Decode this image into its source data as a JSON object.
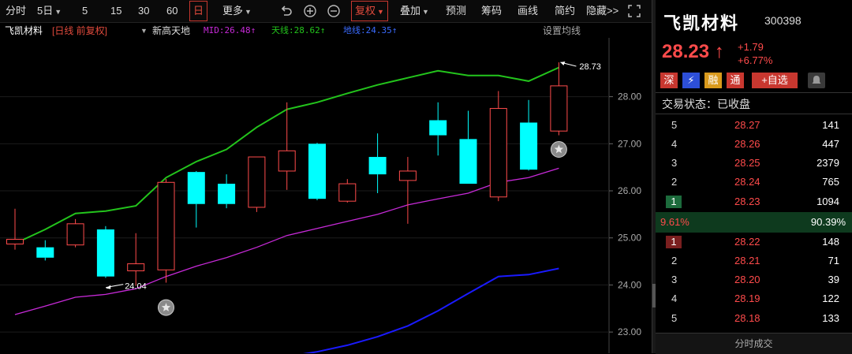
{
  "toolbar": {
    "items": [
      "分时",
      "5日",
      "5",
      "15",
      "30",
      "60",
      "日",
      "更多",
      "复权",
      "叠加",
      "预测",
      "筹码",
      "画线",
      "简约",
      "隐藏>>"
    ]
  },
  "infobar": {
    "name": "飞凯材料",
    "mode": "[日线 前复权]",
    "indicator": "新高天地",
    "mid": "MID:26.48↑",
    "tianxian": "天线:28.62↑",
    "dixian": "地线:24.35↑",
    "settings": "设置均线"
  },
  "colors": {
    "up": "#ff4b4b",
    "down": "#00ffff",
    "green": "#23c41c",
    "mid": "#c72ad8",
    "low": "#1a1aff",
    "accent": "#c8372f"
  },
  "chart_data": {
    "type": "candlestick",
    "y_ticks": [
      "28.00",
      "27.00",
      "26.00",
      "25.00",
      "24.00",
      "23.00"
    ],
    "ylim": [
      22.55,
      29.25
    ],
    "candles": [
      {
        "o": 24.87,
        "h": 25.62,
        "l": 24.75,
        "c": 24.97
      },
      {
        "o": 24.8,
        "h": 24.95,
        "l": 24.52,
        "c": 24.58
      },
      {
        "o": 24.85,
        "h": 25.4,
        "l": 24.8,
        "c": 25.3
      },
      {
        "o": 25.18,
        "h": 25.25,
        "l": 24.15,
        "c": 24.18
      },
      {
        "o": 24.3,
        "h": 25.1,
        "l": 23.98,
        "c": 24.45
      },
      {
        "o": 24.32,
        "h": 26.25,
        "l": 24.05,
        "c": 26.18
      },
      {
        "o": 26.4,
        "h": 26.42,
        "l": 25.22,
        "c": 25.72
      },
      {
        "o": 26.15,
        "h": 26.35,
        "l": 25.63,
        "c": 25.72
      },
      {
        "o": 25.65,
        "h": 26.72,
        "l": 25.55,
        "c": 26.72
      },
      {
        "o": 26.42,
        "h": 27.88,
        "l": 26.02,
        "c": 26.85
      },
      {
        "o": 27.0,
        "h": 27.02,
        "l": 25.8,
        "c": 25.83
      },
      {
        "o": 25.78,
        "h": 26.25,
        "l": 25.75,
        "c": 26.15
      },
      {
        "o": 26.72,
        "h": 27.22,
        "l": 25.95,
        "c": 26.35
      },
      {
        "o": 26.22,
        "h": 26.72,
        "l": 25.3,
        "c": 26.42
      },
      {
        "o": 27.5,
        "h": 27.88,
        "l": 26.75,
        "c": 27.18
      },
      {
        "o": 27.1,
        "h": 27.7,
        "l": 26.15,
        "c": 26.15
      },
      {
        "o": 25.87,
        "h": 28.12,
        "l": 25.78,
        "c": 27.75
      },
      {
        "o": 27.45,
        "h": 27.93,
        "l": 26.43,
        "c": 26.45
      },
      {
        "o": 27.27,
        "h": 28.73,
        "l": 27.18,
        "c": 28.23
      }
    ],
    "series": [
      {
        "name": "天线",
        "color": "#23c41c",
        "values": [
          24.88,
          25.18,
          25.52,
          25.57,
          25.68,
          26.28,
          26.62,
          26.88,
          27.35,
          27.73,
          27.88,
          28.07,
          28.25,
          28.4,
          28.55,
          28.45,
          28.45,
          28.33,
          28.62
        ]
      },
      {
        "name": "MID",
        "color": "#c72ad8",
        "values": [
          23.37,
          23.55,
          23.74,
          23.8,
          23.92,
          24.18,
          24.4,
          24.58,
          24.8,
          25.05,
          25.2,
          25.35,
          25.5,
          25.7,
          25.83,
          25.95,
          26.18,
          26.28,
          26.48
        ]
      },
      {
        "name": "地线",
        "color": "#1a1aff",
        "values": [
          null,
          null,
          null,
          null,
          null,
          null,
          null,
          null,
          null,
          22.48,
          22.58,
          22.72,
          22.9,
          23.13,
          23.45,
          23.82,
          24.18,
          24.22,
          24.35
        ]
      }
    ],
    "annotations": [
      {
        "label": "28.73",
        "candle": 18,
        "value": 28.73
      },
      {
        "label": "24.04",
        "candle": 4,
        "value": 23.98
      }
    ]
  },
  "quote": {
    "name": "飞凯材料",
    "code": "300398",
    "price": "28.23 ↑",
    "change": "+1.79",
    "pct": "+6.77%",
    "tags": [
      "深",
      "⚡",
      "融",
      "通",
      "+自选"
    ],
    "status": "交易状态：已收盘",
    "asks": [
      {
        "lv": "5",
        "price": "28.27",
        "vol": "141"
      },
      {
        "lv": "4",
        "price": "28.26",
        "vol": "447"
      },
      {
        "lv": "3",
        "price": "28.25",
        "vol": "2379"
      },
      {
        "lv": "2",
        "price": "28.24",
        "vol": "765"
      },
      {
        "lv": "1",
        "price": "28.23",
        "vol": "1094"
      }
    ],
    "ratio_left": "9.61%",
    "ratio_right": "90.39%",
    "bids": [
      {
        "lv": "1",
        "price": "28.22",
        "vol": "148"
      },
      {
        "lv": "2",
        "price": "28.21",
        "vol": "71"
      },
      {
        "lv": "3",
        "price": "28.20",
        "vol": "39"
      },
      {
        "lv": "4",
        "price": "28.19",
        "vol": "122"
      },
      {
        "lv": "5",
        "price": "28.18",
        "vol": "133"
      }
    ],
    "footer": "分时成交"
  }
}
